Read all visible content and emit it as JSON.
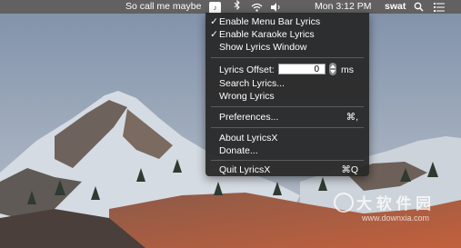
{
  "menubar": {
    "now_playing": "So call me maybe",
    "app_icon": "lyricsx-icon",
    "bluetooth_icon": "bluetooth-icon",
    "wifi_icon": "wifi-icon",
    "volume_icon": "volume-icon",
    "clock": "Mon 3:12 PM",
    "user": "swat",
    "search_icon": "spotlight-search-icon",
    "list_icon": "notification-list-icon"
  },
  "menu": {
    "enable_menu_bar_lyrics": "Enable Menu Bar Lyrics",
    "enable_menu_bar_lyrics_checked": "✓",
    "enable_karaoke_lyrics": "Enable Karaoke Lyrics",
    "enable_karaoke_lyrics_checked": "✓",
    "show_lyrics_window": "Show Lyrics Window",
    "lyrics_offset_label": "Lyrics Offset:",
    "lyrics_offset_value": "0",
    "lyrics_offset_unit": "ms",
    "search_lyrics": "Search Lyrics...",
    "wrong_lyrics": "Wrong Lyrics",
    "preferences": "Preferences...",
    "preferences_shortcut": "⌘,",
    "about": "About LyricsX",
    "donate": "Donate...",
    "quit": "Quit LyricsX",
    "quit_shortcut": "⌘Q"
  },
  "watermark": {
    "text": "大 软 件 园",
    "url": "www.downxia.com"
  },
  "colors": {
    "menubar_bg": "#5f5c5a",
    "menu_bg": "#282828",
    "sky": "#8a9bb0",
    "mountain_snow": "#dfe3e8",
    "rock": "#6b5a50",
    "foreground": "#b5553a"
  }
}
